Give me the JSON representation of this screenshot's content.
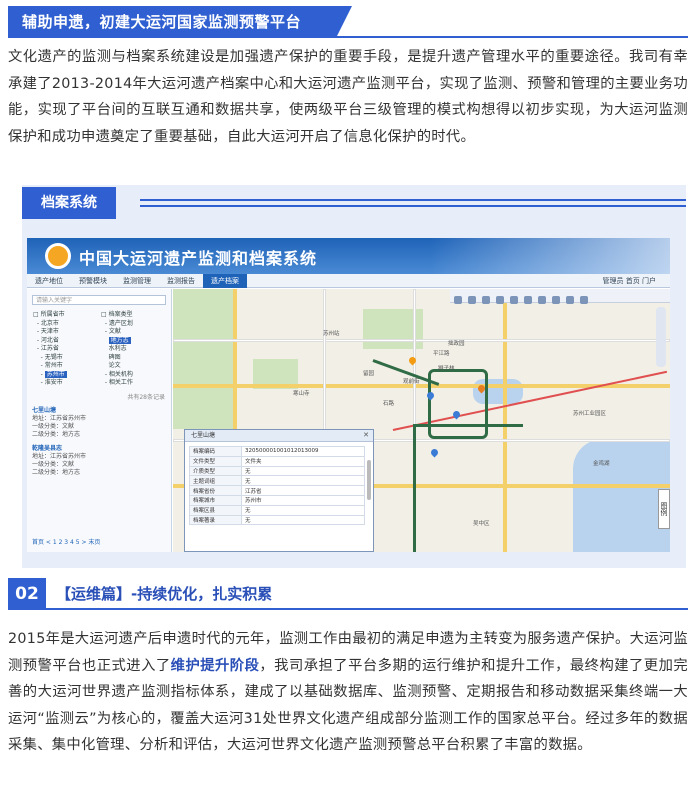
{
  "header": {
    "title": "辅助申遗，初建大运河国家监测预警平台"
  },
  "intro_paragraph": "文化遗产的监测与档案系统建设是加强遗产保护的重要手段，是提升遗产管理水平的重要途径。我司有幸承建了2013-2014年大运河遗产档案中心和大运河遗产监测平台，实现了监测、预警和管理的主要业务功能，实现了平台间的互联互通和数据共享，使两级平台三级管理的模式构想得以初步实现，为大运河监测保护和成功申遗奠定了重要基础，自此大运河开启了信息化保护的时代。",
  "figure": {
    "tab_label": "档案系统",
    "app": {
      "title": "中国大运河遗产监测和档案系统",
      "nav": [
        "遗产地位",
        "预警模块",
        "监测管理",
        "监测报告",
        "遗产档案"
      ],
      "nav_active": 4,
      "nav_right": "管理员  首页  门户",
      "search_placeholder": "请输入关键字",
      "tree_left": [
        "□ 所属省市",
        "  - 北京市",
        "  - 天津市",
        "  - 河北省",
        "  - 江苏省",
        "    - 无锡市",
        "    - 常州市",
        "    - 苏州市",
        "    - 淮安市"
      ],
      "tree_right": [
        "□ 档案类型",
        "  - 遗产区划",
        "  - 文献",
        "    地方志",
        "    水利志",
        "    碑图",
        "    论文",
        "  - 相关机构",
        "  - 相关工作"
      ],
      "tree_selected_left": "苏州市",
      "tree_selected_right": "地方志",
      "results_count": "共有28条记录",
      "items": [
        {
          "name": "七里山塘",
          "addr": "地址：江苏省苏州市",
          "cat1": "一级分类：文献",
          "cat2": "二级分类：地方志"
        },
        {
          "name": "乾隆吴县志",
          "addr": "地址：江苏省苏州市",
          "cat1": "一级分类：文献",
          "cat2": "二级分类：地方志"
        }
      ],
      "pager": "首页 < 1 2 3 4 5 > 末页",
      "popup": {
        "title": "七里山塘",
        "rows": [
          {
            "k": "档案编码",
            "v": "320500001001012013009"
          },
          {
            "k": "文件类型",
            "v": "文件夹"
          },
          {
            "k": "介质类型",
            "v": "无"
          },
          {
            "k": "主题词组",
            "v": "无"
          },
          {
            "k": "档案省份",
            "v": "江苏省"
          },
          {
            "k": "档案城市",
            "v": "苏州市"
          },
          {
            "k": "档案区县",
            "v": "无"
          },
          {
            "k": "档案著录",
            "v": "无"
          }
        ]
      },
      "map_labels": [
        "苏州站",
        "平江路",
        "石路",
        "观前街",
        "苏州乐园",
        "金鸡湖",
        "苏州工业园区",
        "吴中区",
        "狮子林",
        "拙政园",
        "留园",
        "寒山寺"
      ],
      "legend": "图例"
    }
  },
  "section2": {
    "number": "02",
    "title": "【运维篇】-持续优化，扎实积累"
  },
  "para2": {
    "before": "2015年是大运河遗产后申遗时代的元年，监测工作由最初的满足申遗为主转变为服务遗产保护。大运河监测预警平台也正式进入了",
    "highlight": "维护提升阶段",
    "after": "，我司承担了平台多期的运行维护和提升工作，最终构建了更加完善的大运河世界遗产监测指标体系，建成了以基础数据库、监测预警、定期报告和移动数据采集终端一大运河“监测云”为核心的，覆盖大运河31处世界文化遗产组成部分监测工作的国家总平台。经过多年的数据采集、集中化管理、分析和评估，大运河世界文化遗产监测预警总平台积累了丰富的数据。"
  },
  "colors": {
    "accent": "#2f5fd0",
    "highlight": "#2a50b8"
  }
}
